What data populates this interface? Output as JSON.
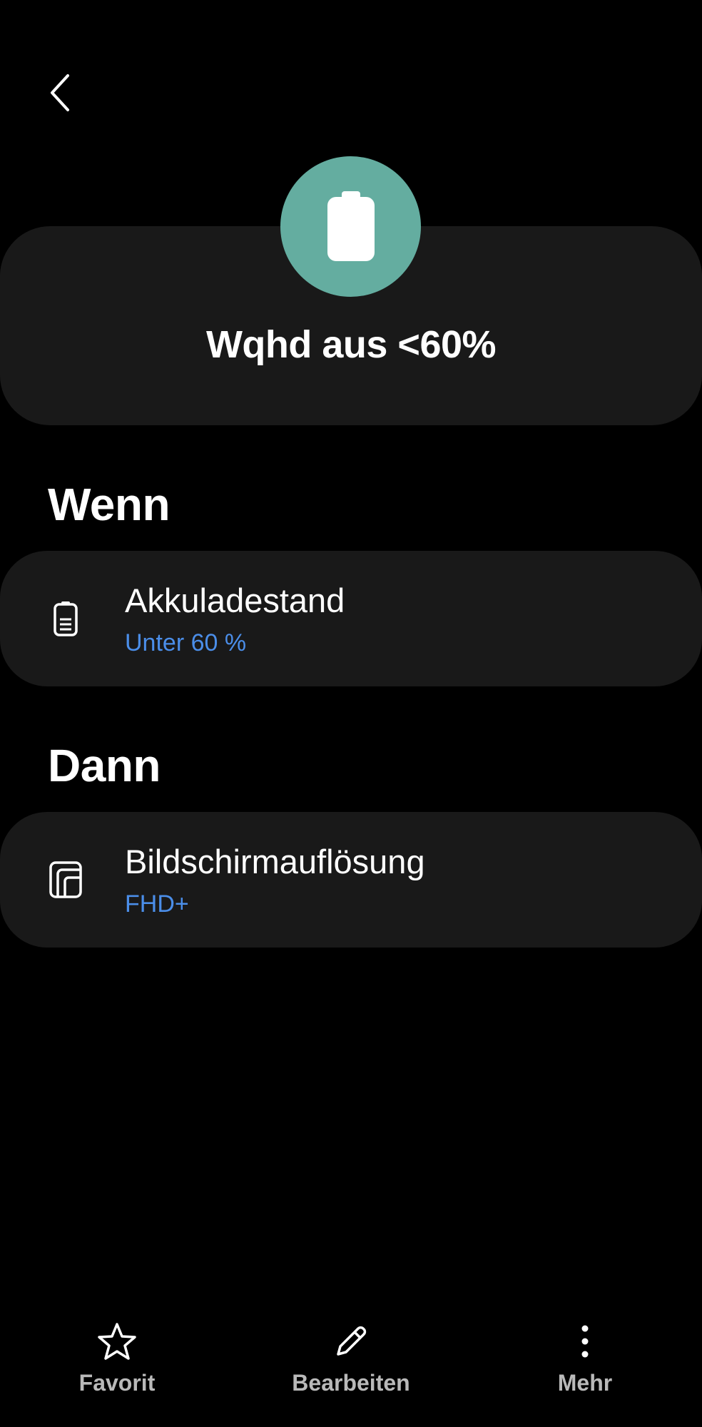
{
  "header": {
    "title": "Wqhd aus <60%",
    "icon": "battery-icon",
    "icon_bg_color": "#64ada0"
  },
  "sections": {
    "when": {
      "label": "Wenn",
      "item": {
        "title": "Akkuladestand",
        "subtitle": "Unter 60 %",
        "icon": "battery-level-icon"
      }
    },
    "then": {
      "label": "Dann",
      "item": {
        "title": "Bildschirmauflösung",
        "subtitle": "FHD+",
        "icon": "screen-resolution-icon"
      }
    }
  },
  "bottom_nav": {
    "favorite": {
      "label": "Favorit",
      "icon": "star-icon"
    },
    "edit": {
      "label": "Bearbeiten",
      "icon": "pencil-icon"
    },
    "more": {
      "label": "Mehr",
      "icon": "more-vertical-icon"
    }
  },
  "colors": {
    "background": "#000000",
    "card": "#191919",
    "accent_blue": "#4b8ee9",
    "muted_label": "#b9b9b9"
  }
}
